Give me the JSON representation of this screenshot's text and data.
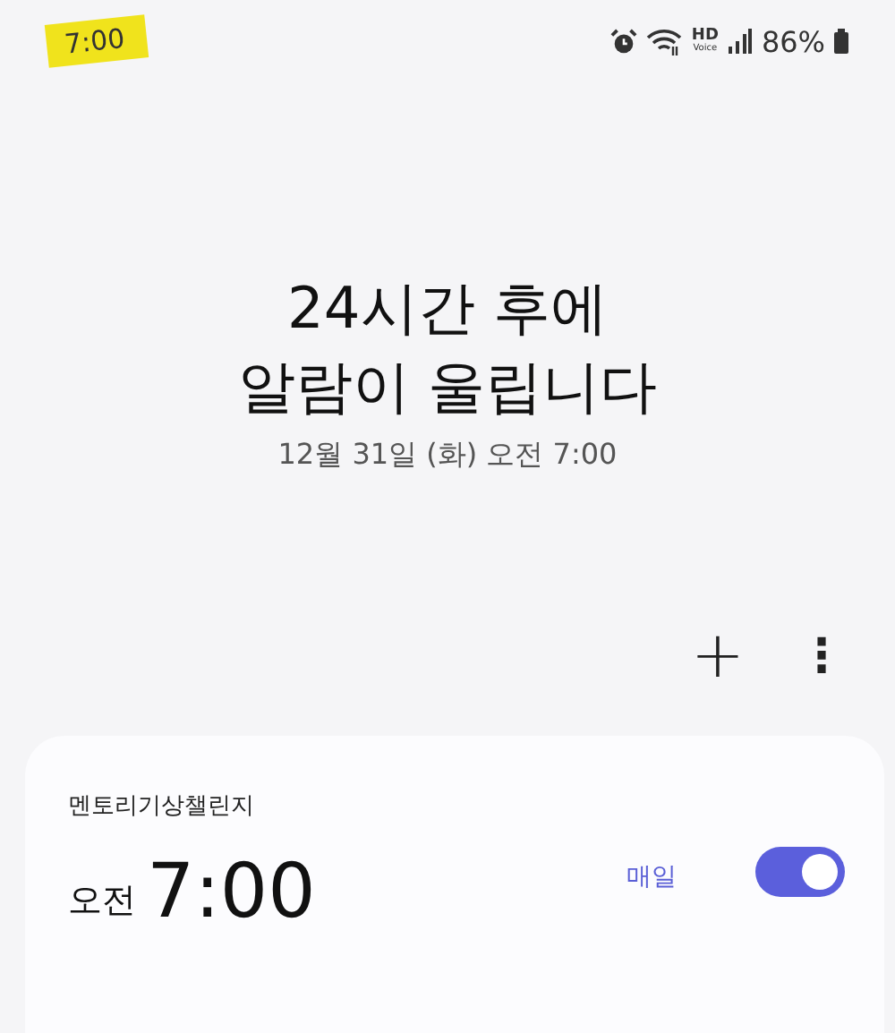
{
  "status_bar": {
    "time": "7:00",
    "hd": "HD",
    "voice": "Voice",
    "battery": "86%"
  },
  "header": {
    "lines": [
      "24시간 후에",
      "알람이 울립니다"
    ],
    "next_alarm": "12월 31일 (화) 오전 7:00"
  },
  "toolbar": {
    "add": "+",
    "more": "⋮"
  },
  "alarms": [
    {
      "name": "멘토리기상챌린지",
      "meridiem": "오전",
      "time": "7:00",
      "repeat": "매일",
      "on": true
    }
  ]
}
